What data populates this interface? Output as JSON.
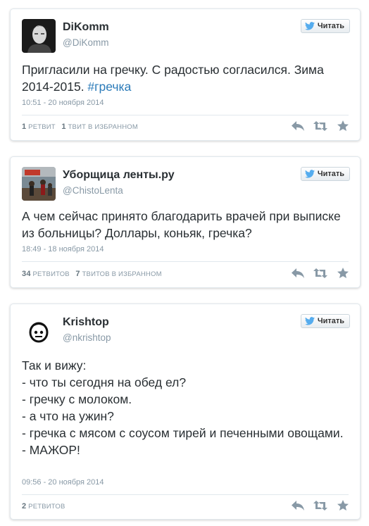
{
  "follow_label": "Читать",
  "tweets": [
    {
      "name": "DiKomm",
      "handle": "@DiKomm",
      "text": "Пригласили на гречку. С радостью согласился. Зима 2014-2015. ",
      "hashtag": "#гречка",
      "time": "10:51 - 20 ноября 2014",
      "retweets_count": "1",
      "retweets_label": "ретвит",
      "favorites_count": "1",
      "favorites_label": "твит в избранном"
    },
    {
      "name": "Уборщица ленты.ру",
      "handle": "@ChistoLenta",
      "text": "А чем сейчас принято благодарить врачей при выписке из больницы? Доллары, коньяк, гречка?",
      "time": "18:49 - 18 ноября 2014",
      "retweets_count": "34",
      "retweets_label": "ретвитов",
      "favorites_count": "7",
      "favorites_label": "твитов в избранном"
    },
    {
      "name": "Krishtop",
      "handle": "@nkrishtop",
      "text": "Так и вижу:\n- что ты сегодня на обед ел?\n- гречку с молоком.\n- а что на ужин?\n- гречка с мясом с соусом тирей и печенными овощами.\n- МАЖОР!",
      "time": "09:56 - 20 ноября 2014",
      "retweets_count": "2",
      "retweets_label": "ретвитов"
    }
  ],
  "icons": {
    "follow": "twitter-bird-icon",
    "reply": "reply-icon",
    "retweet": "retweet-icon",
    "favorite": "star-icon"
  },
  "colors": {
    "link": "#2b7bb9",
    "muted": "#8899a6",
    "text": "#292f33"
  }
}
